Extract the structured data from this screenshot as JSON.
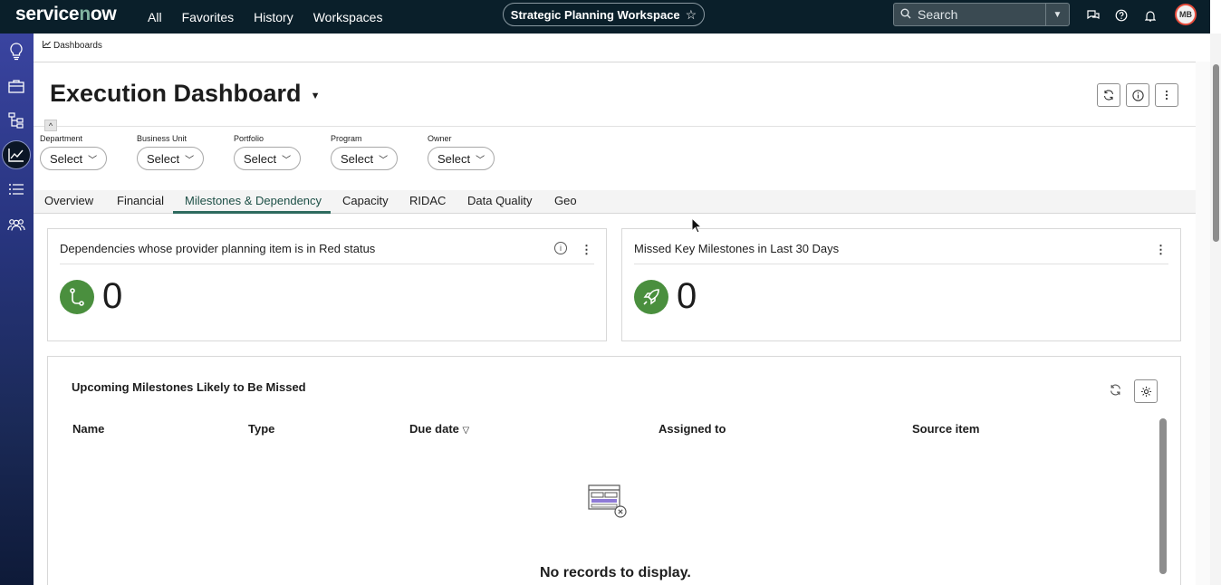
{
  "topnav": {
    "logo": "servicenow",
    "menu": [
      "All",
      "Favorites",
      "History",
      "Workspaces"
    ],
    "workspace": "Strategic Planning Workspace",
    "search_placeholder": "Search",
    "avatar_initials": "MB"
  },
  "breadcrumb": "Dashboards",
  "dashboard": {
    "title": "Execution Dashboard"
  },
  "filters": [
    {
      "label": "Department",
      "value": "Select"
    },
    {
      "label": "Business Unit",
      "value": "Select"
    },
    {
      "label": "Portfolio",
      "value": "Select"
    },
    {
      "label": "Program",
      "value": "Select"
    },
    {
      "label": "Owner",
      "value": "Select"
    }
  ],
  "tabs": [
    "Overview",
    "Financial",
    "Milestones & Dependency",
    "Capacity",
    "RIDAC",
    "Data Quality",
    "Geo"
  ],
  "active_tab": "Milestones & Dependency",
  "cards": {
    "dependencies": {
      "title": "Dependencies whose provider planning item is in Red status",
      "value": "0",
      "icon": "dependency-icon"
    },
    "missed": {
      "title": "Missed Key Milestones in Last 30 Days",
      "value": "0",
      "icon": "rocket-icon"
    }
  },
  "milestones_table": {
    "title": "Upcoming Milestones Likely to Be Missed",
    "columns": [
      "Name",
      "Type",
      "Due date",
      "Assigned to",
      "Source item"
    ],
    "empty_message": "No records to display."
  },
  "colors": {
    "nav_bg": "#0a1f2a",
    "accent_green": "#2e6b5f",
    "kpi_green": "#4a8f3e",
    "sidebar_top": "#3a44a0"
  }
}
